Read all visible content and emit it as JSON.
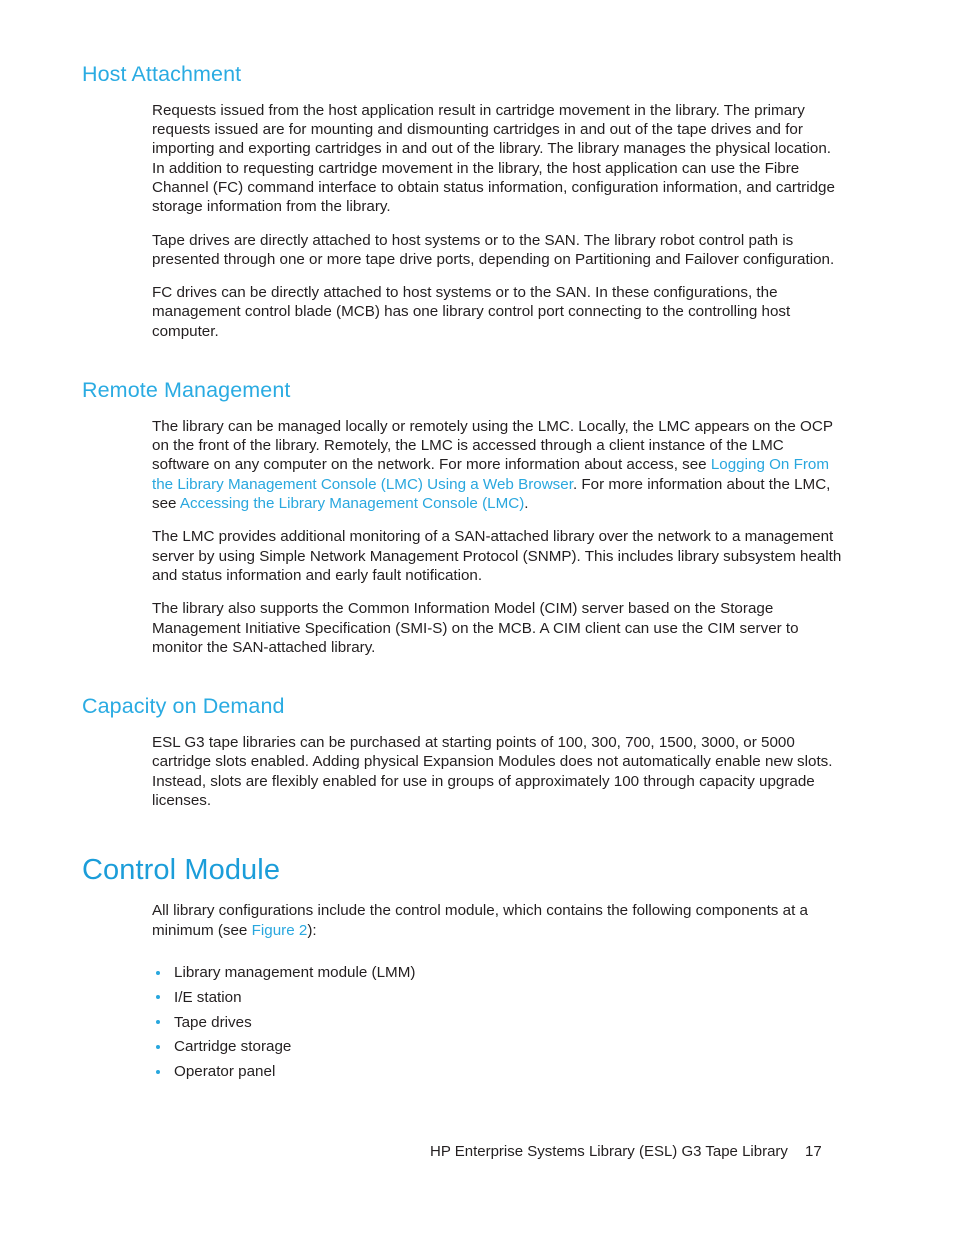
{
  "document": {
    "footer": {
      "title": "HP Enterprise Systems Library (ESL) G3 Tape Library",
      "page_number": "17"
    },
    "colors": {
      "section_heading": "#2aabe2",
      "chapter_heading": "#1b9dd9",
      "link": "#29a7de",
      "body_text": "#231f20",
      "background": "#ffffff"
    }
  },
  "sections": {
    "host_attachment": {
      "heading": "Host Attachment",
      "paragraphs": {
        "p1": "Requests issued from the host application result in cartridge movement in the library. The primary requests issued are for mounting and dismounting cartridges in and out of the tape drives and for importing and exporting cartridges in and out of the library. The library manages the physical location. In addition to requesting cartridge movement in the library, the host application can use the Fibre Channel (FC) command interface to obtain status information, configuration information, and cartridge storage information from the library.",
        "p2": "Tape drives are directly attached to host systems or to the SAN. The library robot control path is presented through one or more tape drive ports, depending on Partitioning and Failover configuration.",
        "p3": "FC drives can be directly attached to host systems or to the SAN. In these configurations, the management control blade (MCB) has one library control port connecting to the controlling host computer."
      }
    },
    "remote_management": {
      "heading": "Remote Management",
      "paragraphs": {
        "p1_part1": "The library can be managed locally or remotely using the LMC. Locally, the LMC appears on the OCP on the front of the library. Remotely, the LMC is accessed through a client instance of the LMC software on any computer on the network. For more information about access, see ",
        "p1_link1": "Logging On From the Library Management Console (LMC) Using a Web Browser",
        "p1_part2": ". For more information about the LMC, see ",
        "p1_link2": "Accessing the Library Management Console (LMC)",
        "p1_part3": ".",
        "p2": "The LMC provides additional monitoring of a SAN-attached library over the network to a management server by using Simple Network Management Protocol (SNMP). This includes library subsystem health and status information and early fault notification.",
        "p3": "The library also supports the Common Information Model (CIM) server based on the Storage Management Initiative Specification (SMI-S) on the MCB. A CIM client can use the CIM server to monitor the SAN-attached library."
      }
    },
    "capacity_on_demand": {
      "heading": "Capacity on Demand",
      "paragraphs": {
        "p1": "ESL G3 tape libraries can be purchased at starting points of 100, 300, 700, 1500, 3000, or 5000 cartridge slots enabled. Adding physical Expansion Modules does not automatically enable new slots. Instead, slots are flexibly enabled for use in groups of approximately 100 through capacity upgrade licenses."
      }
    },
    "control_module": {
      "heading": "Control Module",
      "intro_part1": "All library configurations include the control module, which contains the following components at a minimum (see ",
      "intro_link": "Figure 2",
      "intro_part2": "):",
      "bullets": [
        "Library management module (LMM)",
        "I/E station",
        "Tape drives",
        "Cartridge storage",
        "Operator panel"
      ]
    }
  }
}
